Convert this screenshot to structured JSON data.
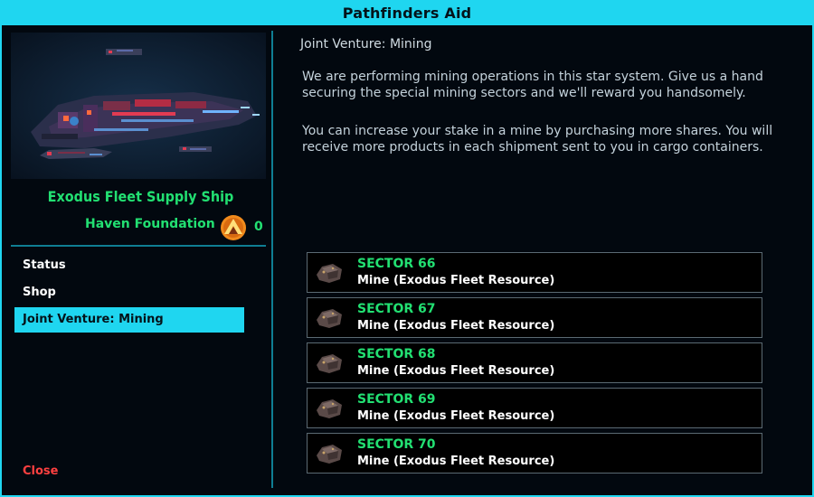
{
  "window": {
    "title": "Pathfinders Aid",
    "accent_color": "#1fd6f0"
  },
  "left": {
    "ship_name": "Exodus Fleet Supply Ship",
    "faction": {
      "name": "Haven Foundation",
      "icon": "faction-emblem-icon",
      "count": "0"
    },
    "nav": [
      {
        "label": "Status",
        "active": false
      },
      {
        "label": "Shop",
        "active": false
      },
      {
        "label": "Joint Venture: Mining",
        "active": true
      }
    ],
    "close_label": "Close"
  },
  "main": {
    "title": "Joint Venture: Mining",
    "paragraphs": [
      "We are performing mining operations in this star system. Give us a hand securing the special mining sectors and we'll reward you handsomely.",
      "You can increase your stake in a mine by purchasing more shares. You will receive more products in each shipment sent to you in cargo containers."
    ],
    "sectors": [
      {
        "name": "SECTOR 66",
        "type": "Mine (Exodus Fleet Resource)",
        "icon": "ore-rock-icon"
      },
      {
        "name": "SECTOR 67",
        "type": "Mine (Exodus Fleet Resource)",
        "icon": "ore-rock-icon"
      },
      {
        "name": "SECTOR 68",
        "type": "Mine (Exodus Fleet Resource)",
        "icon": "ore-rock-icon"
      },
      {
        "name": "SECTOR 69",
        "type": "Mine (Exodus Fleet Resource)",
        "icon": "ore-rock-icon"
      },
      {
        "name": "SECTOR 70",
        "type": "Mine (Exodus Fleet Resource)",
        "icon": "ore-rock-icon"
      }
    ]
  }
}
